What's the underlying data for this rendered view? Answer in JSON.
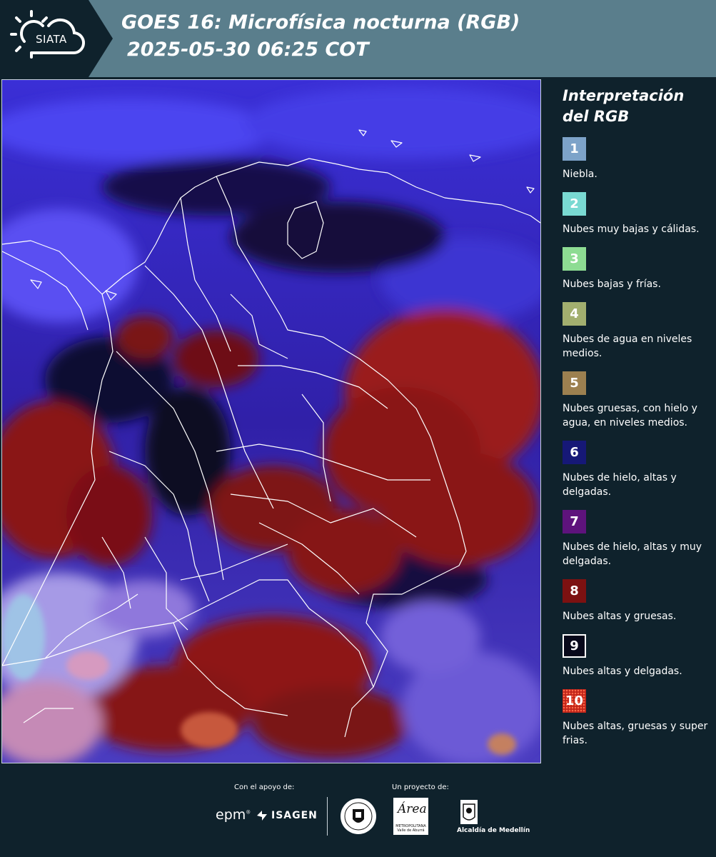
{
  "header": {
    "logo_text": "SIATA",
    "title_line1": "GOES 16: Microfísica nocturna (RGB)",
    "title_line2": "2025-05-30 06:25 COT"
  },
  "legend": {
    "title_line1": "Interpretación",
    "title_line2": "del RGB",
    "items": [
      {
        "num": "1",
        "color": "#7da3c9",
        "label": "Niebla."
      },
      {
        "num": "2",
        "color": "#79d9d2",
        "label": "Nubes muy bajas y cálidas."
      },
      {
        "num": "3",
        "color": "#8ddc93",
        "label": "Nubes bajas y frías."
      },
      {
        "num": "4",
        "color": "#a2af6f",
        "label": "Nubes de agua en niveles medios."
      },
      {
        "num": "5",
        "color": "#9c8050",
        "label": "Nubes gruesas, con hielo y agua, en niveles medios."
      },
      {
        "num": "6",
        "color": "#161877",
        "label": "Nubes de hielo, altas y delgadas."
      },
      {
        "num": "7",
        "color": "#5e137c",
        "label": "Nubes de hielo, altas y muy delgadas."
      },
      {
        "num": "8",
        "color": "#7c1111",
        "label": "Nubes altas y gruesas."
      },
      {
        "num": "9",
        "color": "#07081a",
        "label": "Nubes altas y delgadas."
      },
      {
        "num": "10",
        "color": "#c0241a",
        "label": "Nubes altas, gruesas y super frias."
      }
    ]
  },
  "footer": {
    "support_label": "Con el apoyo de:",
    "project_label": "Un proyecto de:",
    "epm": "epm",
    "isagen": "ISAGEN",
    "area_script": "Área",
    "area_small": "METROPOLITANA Valle de Aburrá",
    "alcaldia": "Alcaldía de Medellín"
  }
}
